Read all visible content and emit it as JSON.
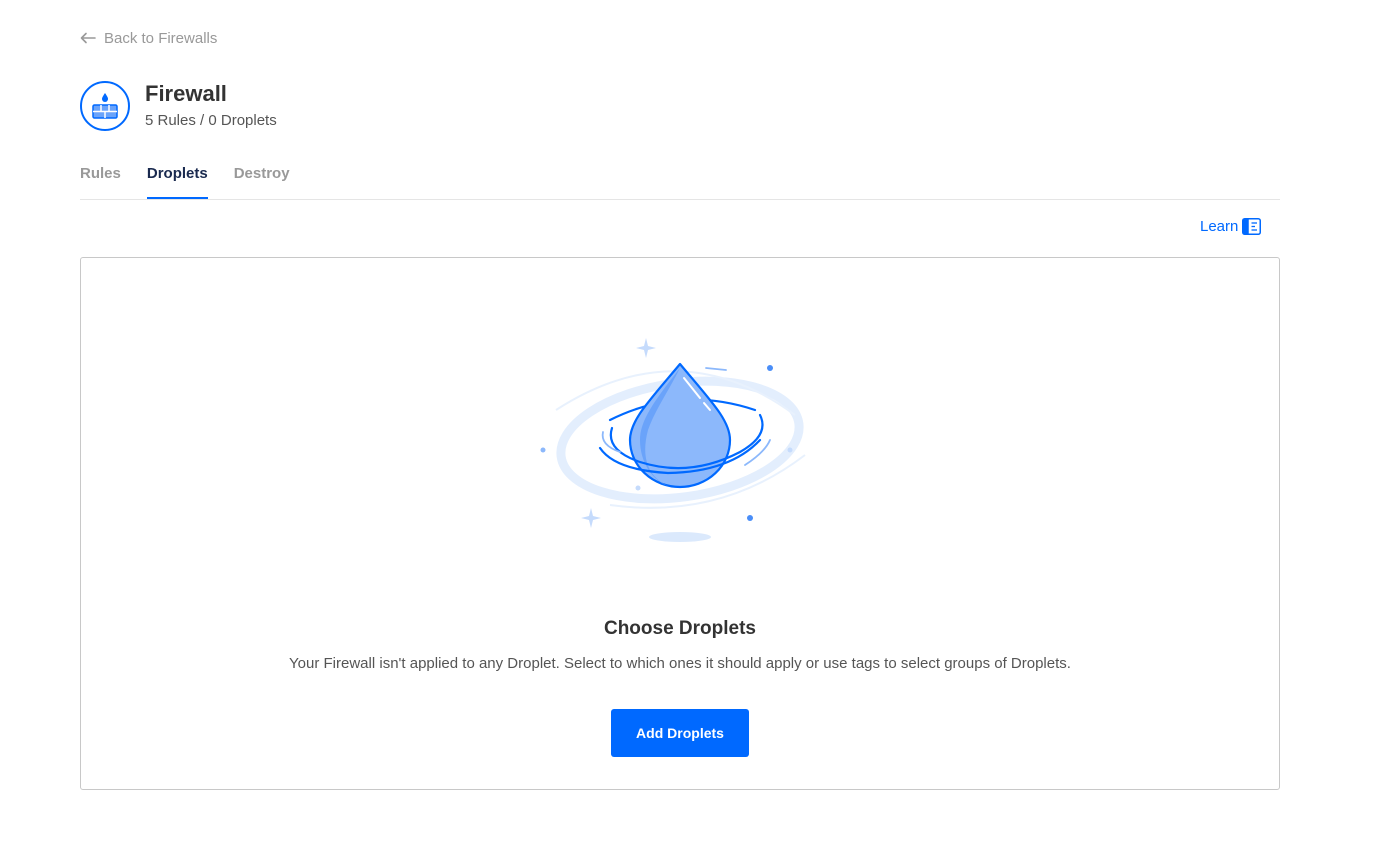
{
  "nav": {
    "back_label": "Back to Firewalls",
    "back_icon": "arrow-left-icon"
  },
  "header": {
    "icon": "firewall-icon",
    "title": "Firewall",
    "subtitle": "5 Rules / 0 Droplets"
  },
  "tabs": [
    {
      "label": "Rules",
      "active": false
    },
    {
      "label": "Droplets",
      "active": true
    },
    {
      "label": "Destroy",
      "active": false
    }
  ],
  "learn": {
    "label": "Learn",
    "icon": "document-icon"
  },
  "empty_state": {
    "illustration": "droplet-illustration",
    "title": "Choose Droplets",
    "description": "Your Firewall isn't applied to any Droplet. Select to which ones it should apply or use tags to select groups of Droplets.",
    "button_label": "Add Droplets"
  },
  "colors": {
    "accent": "#0069ff",
    "active_tab": "#1a2a4f",
    "muted": "#999999",
    "border": "#c8c8c8",
    "illustration_light": "#8cb8fb",
    "illustration_pale": "#dbe9fc"
  }
}
